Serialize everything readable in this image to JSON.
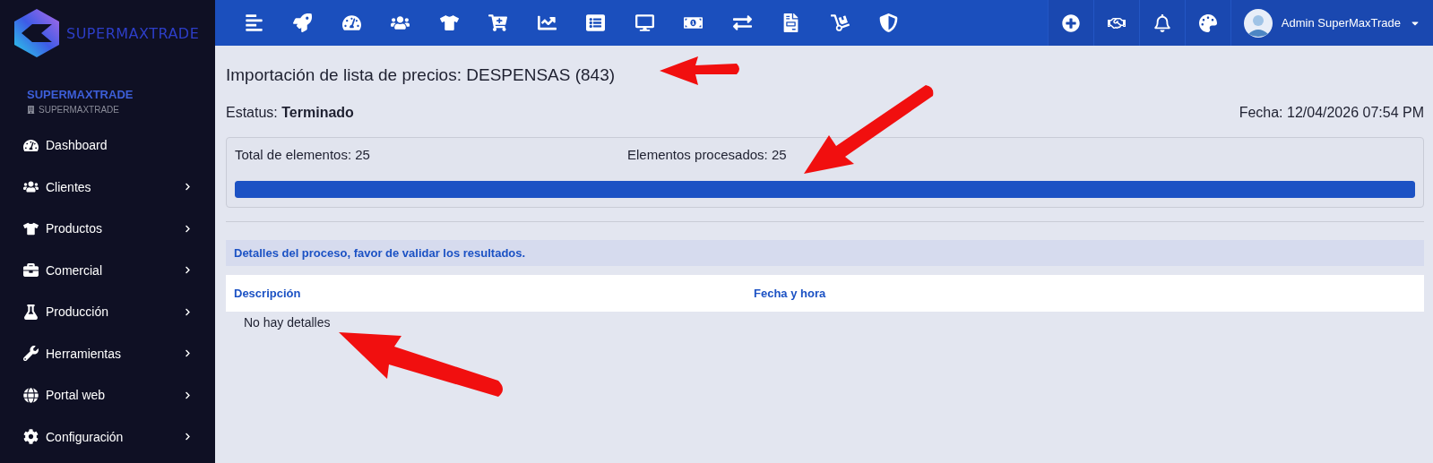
{
  "brand": {
    "logo_text": "SUPERMAXTRADE",
    "company": "SUPERMAXTRADE",
    "branch": "SUPERMAXTRADE"
  },
  "sidebar": {
    "items": [
      {
        "label": "Dashboard",
        "has_submenu": false
      },
      {
        "label": "Clientes",
        "has_submenu": true
      },
      {
        "label": "Productos",
        "has_submenu": true
      },
      {
        "label": "Comercial",
        "has_submenu": true
      },
      {
        "label": "Producción",
        "has_submenu": true
      },
      {
        "label": "Herramientas",
        "has_submenu": true
      },
      {
        "label": "Portal web",
        "has_submenu": true
      },
      {
        "label": "Configuración",
        "has_submenu": true
      }
    ]
  },
  "topbar": {
    "user": "Admin SuperMaxTrade"
  },
  "page": {
    "title": "Importación de lista de precios: DESPENSAS (843)",
    "status_label": "Estatus:",
    "status_value": "Terminado",
    "date": "Fecha: 12/04/2026 07:54 PM",
    "progress": {
      "total": "Total de elementos: 25",
      "processed": "Elementos procesados: 25",
      "level": 1
    },
    "details_title": "Detalles del proceso, favor de validar los resultados.",
    "table": {
      "columns": [
        "Descripción",
        "Fecha y hora"
      ],
      "empty": "No hay detalles"
    }
  }
}
